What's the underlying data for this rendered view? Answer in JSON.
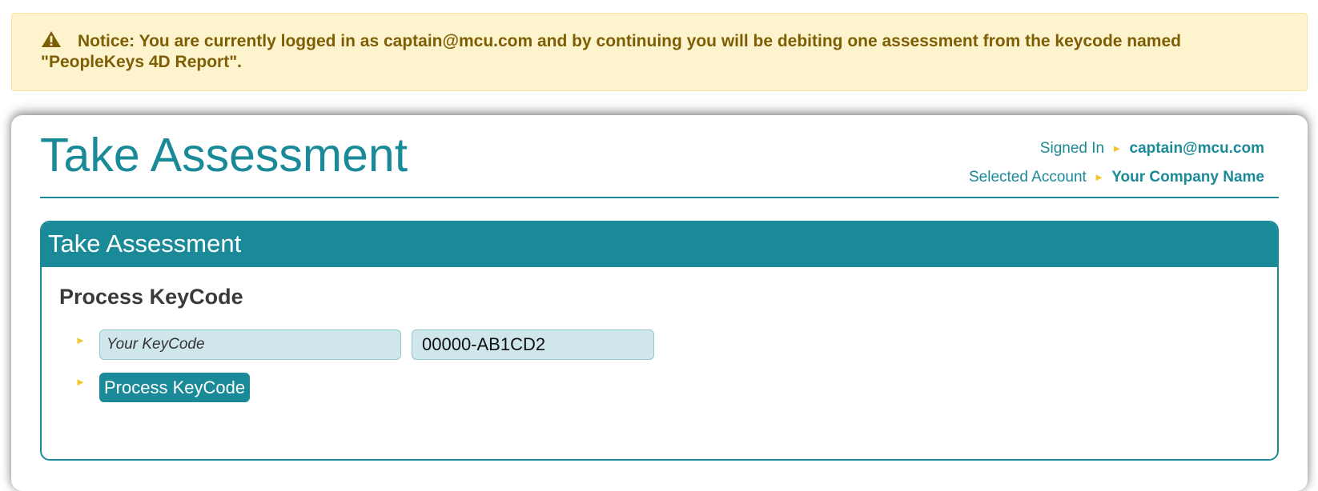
{
  "notice": {
    "icon": "warning-icon",
    "text": "Notice: You are currently logged in as captain@mcu.com and by continuing you will be debiting one assessment from the keycode named \"PeopleKeys 4D Report\"."
  },
  "header": {
    "title": "Take Assessment",
    "signed_in_label": "Signed In",
    "signed_in_value": "captain@mcu.com",
    "account_label": "Selected Account",
    "account_value": "Your Company Name",
    "arrow": "►"
  },
  "panel": {
    "title": "Take Assessment",
    "section_title": "Process KeyCode",
    "keycode_label_value": "Your KeyCode",
    "keycode_value": "00000-AB1CD2",
    "process_button_label": "Process KeyCode",
    "bullet": "►"
  },
  "colors": {
    "accent": "#1b8a98",
    "notice_bg": "#fdf3cd",
    "notice_text": "#7d5e05",
    "bullet": "#f5c52b",
    "field_bg": "#cfe6ea"
  }
}
